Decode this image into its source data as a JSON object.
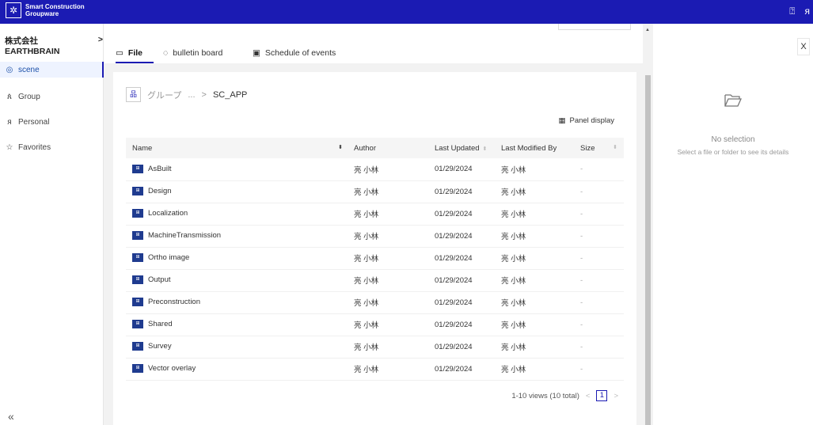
{
  "app": {
    "logo_icon": "✲",
    "name_line1": "Smart Construction",
    "name_line2": "Groupware",
    "help_icon": "⍰",
    "user_icon": "ᴙ"
  },
  "sidebar": {
    "company": "株式会社 EARTHBRAIN",
    "company_chevron": ">",
    "items": [
      {
        "icon": "◎",
        "label": "scene"
      },
      {
        "icon": "ጰ",
        "label": "Group"
      },
      {
        "icon": "ᴙ",
        "label": "Personal"
      },
      {
        "icon": "☆",
        "label": "Favorites"
      }
    ],
    "collapse": "«"
  },
  "tabs": [
    {
      "icon": "▭",
      "label": "File"
    },
    {
      "icon": "◌",
      "label": "bulletin board"
    },
    {
      "icon": "▣",
      "label": "Schedule of events"
    }
  ],
  "breadcrumb": {
    "icon": "品",
    "root": "グループ",
    "ellipsis": "...",
    "separator": ">",
    "current": "SC_APP"
  },
  "panel_display": {
    "icon": "▦",
    "label": "Panel display"
  },
  "table": {
    "headers": {
      "name": "Name",
      "author": "Author",
      "last_updated": "Last Updated",
      "last_modified_by": "Last Modified By",
      "size": "Size"
    },
    "sort_icon": "⬍",
    "rows": [
      {
        "name": "AsBuilt",
        "author": "亮 小林",
        "updated": "01/29/2024",
        "modified_by": "亮 小林",
        "size": "-"
      },
      {
        "name": "Design",
        "author": "亮 小林",
        "updated": "01/29/2024",
        "modified_by": "亮 小林",
        "size": "-"
      },
      {
        "name": "Localization",
        "author": "亮 小林",
        "updated": "01/29/2024",
        "modified_by": "亮 小林",
        "size": "-"
      },
      {
        "name": "MachineTransmission",
        "author": "亮 小林",
        "updated": "01/29/2024",
        "modified_by": "亮 小林",
        "size": "-"
      },
      {
        "name": "Ortho image",
        "author": "亮 小林",
        "updated": "01/29/2024",
        "modified_by": "亮 小林",
        "size": "-"
      },
      {
        "name": "Output",
        "author": "亮 小林",
        "updated": "01/29/2024",
        "modified_by": "亮 小林",
        "size": "-"
      },
      {
        "name": "Preconstruction",
        "author": "亮 小林",
        "updated": "01/29/2024",
        "modified_by": "亮 小林",
        "size": "-"
      },
      {
        "name": "Shared",
        "author": "亮 小林",
        "updated": "01/29/2024",
        "modified_by": "亮 小林",
        "size": "-"
      },
      {
        "name": "Survey",
        "author": "亮 小林",
        "updated": "01/29/2024",
        "modified_by": "亮 小林",
        "size": "-"
      },
      {
        "name": "Vector overlay",
        "author": "亮 小林",
        "updated": "01/29/2024",
        "modified_by": "亮 小林",
        "size": "-"
      }
    ]
  },
  "pagination": {
    "summary": "1-10 views (10 total)",
    "prev": "<",
    "page": "1",
    "next": ">"
  },
  "details": {
    "close": "X",
    "title": "No selection",
    "subtitle": "Select a file or folder to see its details"
  }
}
